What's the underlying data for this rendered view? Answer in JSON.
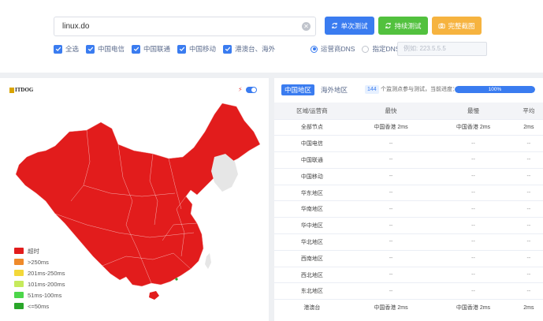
{
  "search": {
    "value": "linux.do"
  },
  "buttons": {
    "single": "单次测试",
    "continuous": "持续测试",
    "screenshot": "完整截图"
  },
  "filters": [
    "全选",
    "中国电信",
    "中国联通",
    "中国移动",
    "港澳台、海外"
  ],
  "dns": {
    "operator_label": "运营商DNS",
    "custom_label": "指定DNS:",
    "custom_placeholder": "例如: 223.5.5.5",
    "selected": "运营商DNS"
  },
  "map": {
    "logo_text": "ITDOG",
    "legend": [
      {
        "label": "超时",
        "color": "#e21c1c"
      },
      {
        "label": ">250ms",
        "color": "#ef8a2a"
      },
      {
        "label": "201ms-250ms",
        "color": "#f3d83a"
      },
      {
        "label": "101ms-200ms",
        "color": "#c6ea5c"
      },
      {
        "label": "51ms-100ms",
        "color": "#4cd64a"
      },
      {
        "label": "<=50ms",
        "color": "#2aa62a"
      }
    ]
  },
  "results": {
    "tabs": [
      "中国地区",
      "海外地区"
    ],
    "active_tab": "中国地区",
    "node_count": "144",
    "progress_text": "个监测点参与测试，当前进度：",
    "progress": "100%",
    "progress_value": 1.0,
    "columns": [
      "区域/运营商",
      "最快",
      "最慢",
      "平均"
    ],
    "rows": [
      {
        "region": "全部节点",
        "fastest": "中国香港 2ms",
        "slowest": "中国香港 2ms",
        "avg": "2ms"
      },
      {
        "region": "中国电信",
        "fastest": "--",
        "slowest": "--",
        "avg": "--"
      },
      {
        "region": "中国联通",
        "fastest": "--",
        "slowest": "--",
        "avg": "--"
      },
      {
        "region": "中国移动",
        "fastest": "--",
        "slowest": "--",
        "avg": "--"
      },
      {
        "region": "华东地区",
        "fastest": "--",
        "slowest": "--",
        "avg": "--"
      },
      {
        "region": "华南地区",
        "fastest": "--",
        "slowest": "--",
        "avg": "--"
      },
      {
        "region": "华中地区",
        "fastest": "--",
        "slowest": "--",
        "avg": "--"
      },
      {
        "region": "华北地区",
        "fastest": "--",
        "slowest": "--",
        "avg": "--"
      },
      {
        "region": "西南地区",
        "fastest": "--",
        "slowest": "--",
        "avg": "--"
      },
      {
        "region": "西北地区",
        "fastest": "--",
        "slowest": "--",
        "avg": "--"
      },
      {
        "region": "东北地区",
        "fastest": "--",
        "slowest": "--",
        "avg": "--"
      },
      {
        "region": "港澳台",
        "fastest": "中国香港 2ms",
        "slowest": "中国香港 2ms",
        "avg": "2ms"
      }
    ]
  },
  "colors": {
    "accent": "#3a7cf0",
    "success": "#52c13e",
    "warning": "#f6b33f",
    "timeout": "#e21c1c"
  }
}
